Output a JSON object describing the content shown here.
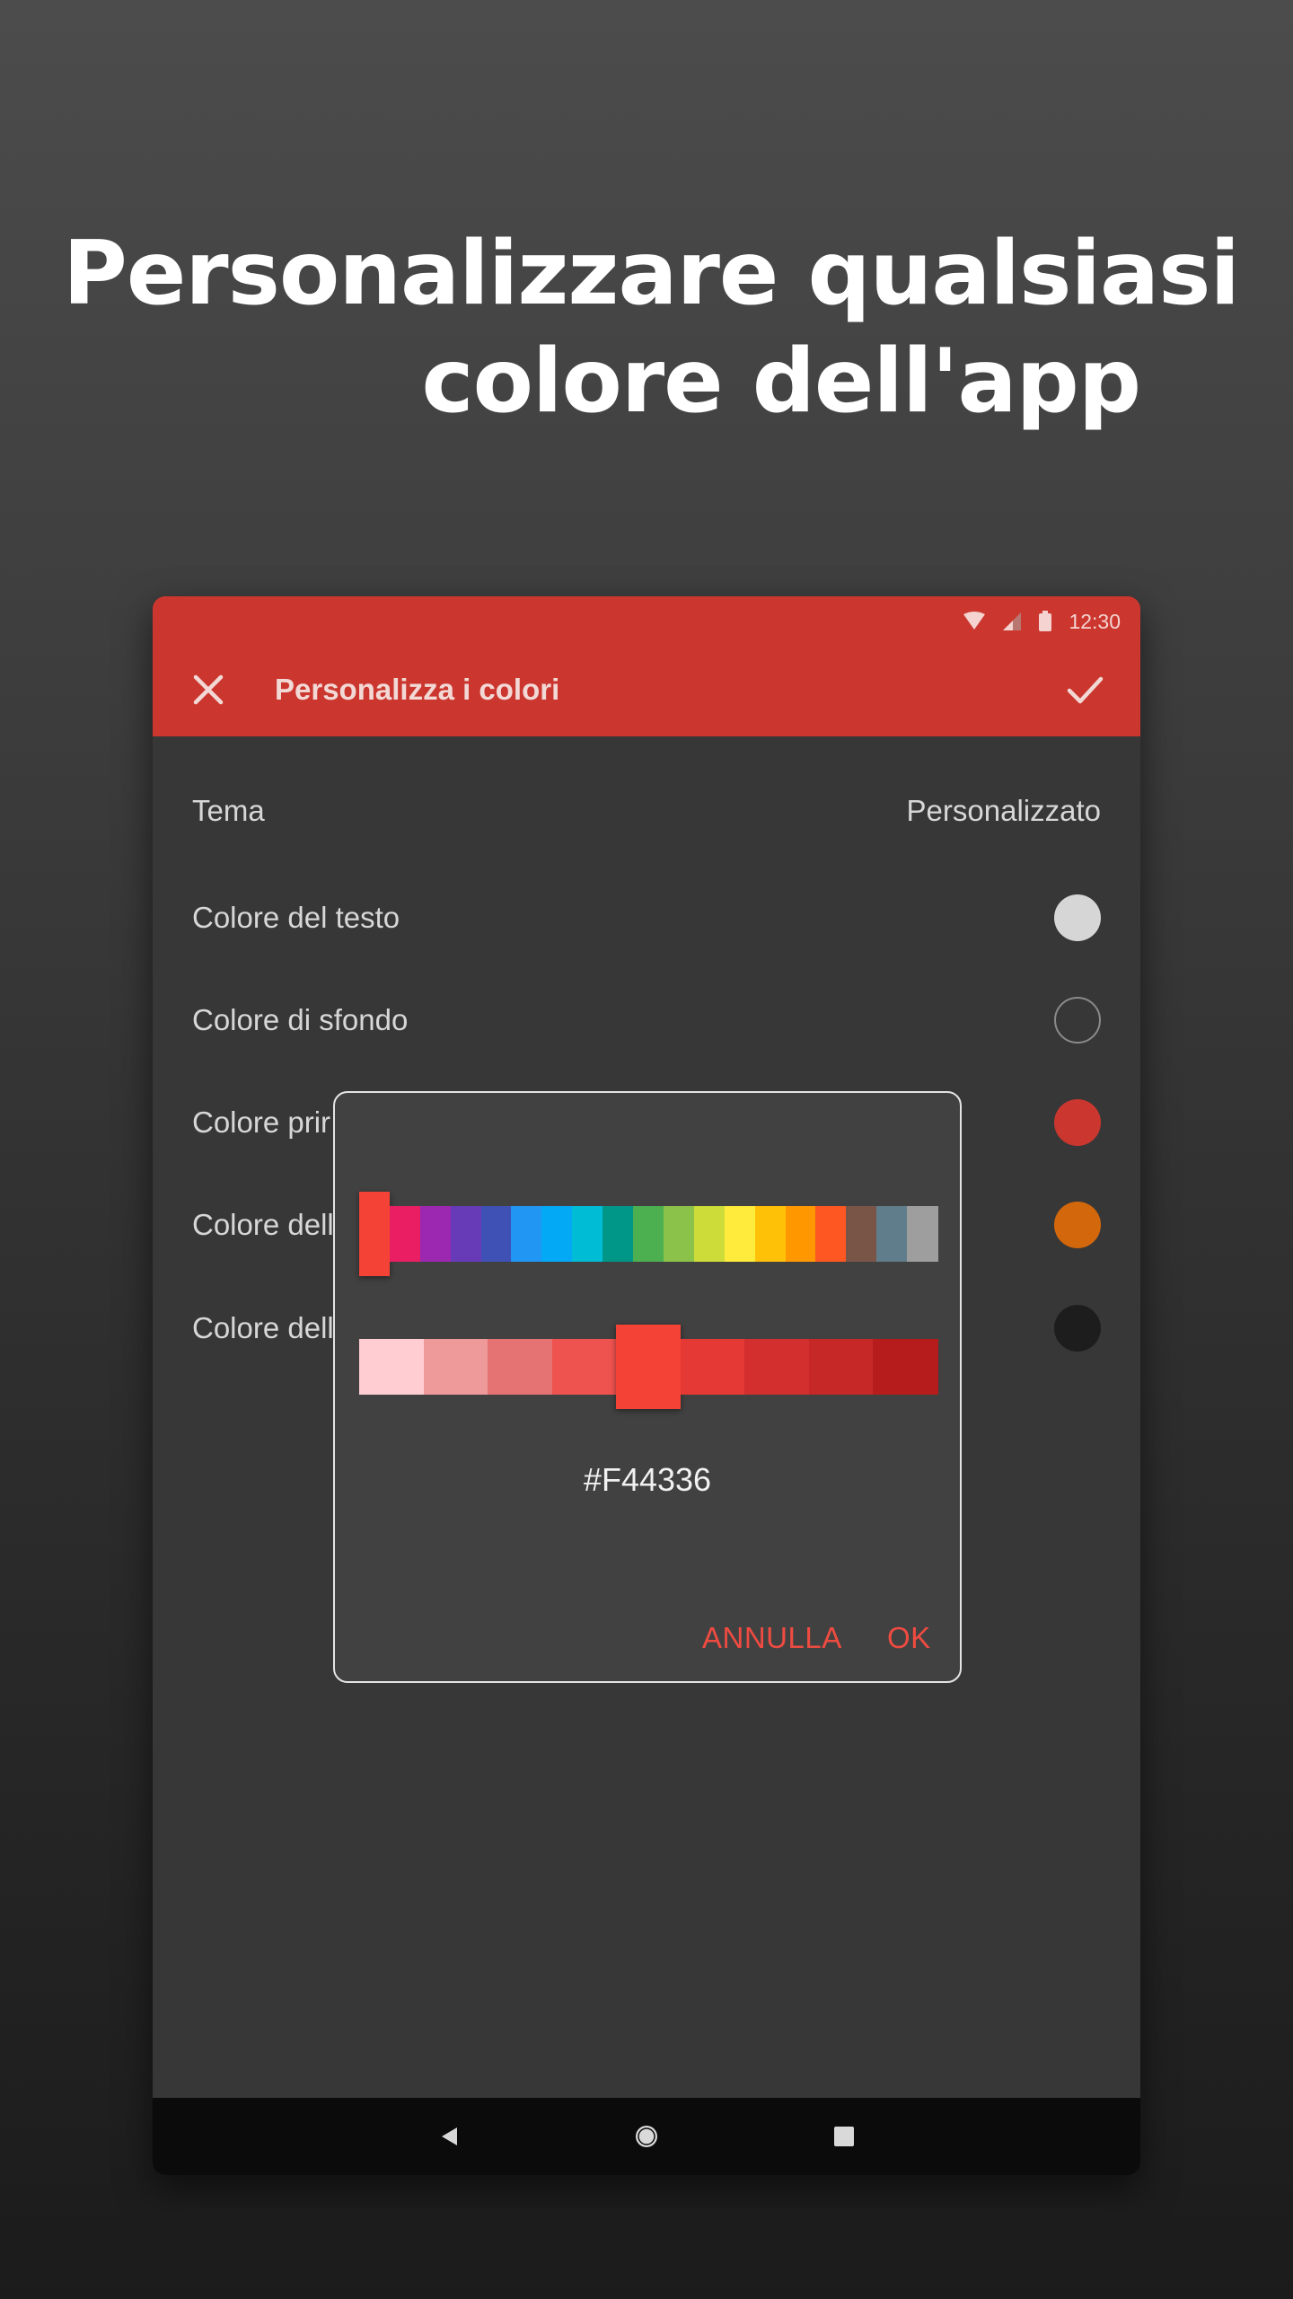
{
  "headline": {
    "line1": "Personalizzare qualsiasi",
    "line2": "colore dell'app"
  },
  "status_bar": {
    "time": "12:30",
    "icons": [
      "wifi-icon",
      "signal-icon",
      "battery-icon"
    ]
  },
  "app_bar": {
    "title": "Personalizza i colori",
    "left_icon": "close-icon",
    "right_icon": "check-icon",
    "color": "#cb372f"
  },
  "settings": {
    "theme": {
      "label": "Tema",
      "value": "Personalizzato"
    },
    "rows": [
      {
        "label": "Colore del testo",
        "color": "#d6d6d6"
      },
      {
        "label": "Colore di sfondo",
        "color": "#383738"
      },
      {
        "label": "Colore prir",
        "color": "#cb372f"
      },
      {
        "label": "Colore dell",
        "color": "#d2670b"
      },
      {
        "label": "Colore dell",
        "color": "#1e1d1e"
      }
    ]
  },
  "color_picker": {
    "hues": [
      "#f44336",
      "#e91e63",
      "#9c27b0",
      "#673ab7",
      "#3f51b5",
      "#2196f3",
      "#03a9f4",
      "#00bcd4",
      "#009688",
      "#4caf50",
      "#8bc34a",
      "#cddc39",
      "#ffeb3b",
      "#ffc107",
      "#ff9800",
      "#ff5722",
      "#795548",
      "#607d8b",
      "#9e9e9e"
    ],
    "selected_hue_index": 0,
    "shades": [
      "#ffcdd2",
      "#ef9a9a",
      "#e57373",
      "#ef5350",
      "#f44336",
      "#e53935",
      "#d32f2f",
      "#c62828",
      "#b71c1c"
    ],
    "selected_shade_index": 4,
    "hex_value": "#F44336",
    "cancel_label": "ANNULLA",
    "ok_label": "OK",
    "button_color": "#ef4b41"
  },
  "nav_bar": {
    "icons": [
      "back-icon",
      "home-icon",
      "recents-icon"
    ]
  }
}
